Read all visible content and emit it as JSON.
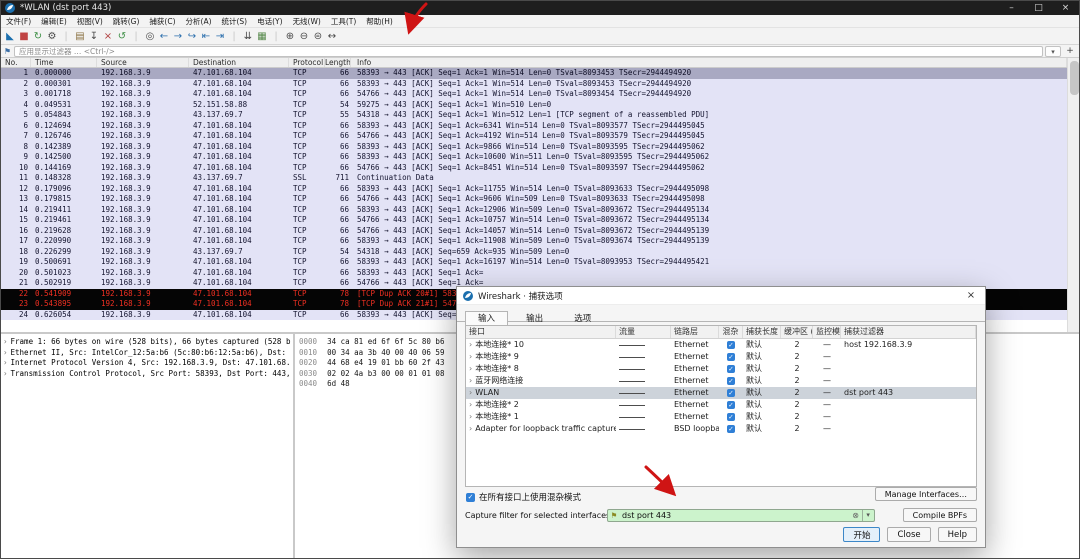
{
  "glyphs": {
    "check": "✓",
    "expander": "›",
    "minimize": "–",
    "maximize": "□",
    "close": "×",
    "dropdown": "▾",
    "add": "+",
    "bookmark": "⚑",
    "clear": "⊗"
  },
  "window": {
    "title": "*WLAN (dst port 443)"
  },
  "menubar": {
    "items": [
      "文件(F)",
      "编辑(E)",
      "视图(V)",
      "跳转(G)",
      "捕获(C)",
      "分析(A)",
      "统计(S)",
      "电话(Y)",
      "无线(W)",
      "工具(T)",
      "帮助(H)"
    ]
  },
  "toolbar": {
    "icons": [
      {
        "name": "start-capture-icon",
        "glyph": "◣",
        "color": "#1b6fae"
      },
      {
        "name": "stop-capture-icon",
        "glyph": "■",
        "color": "#c04343"
      },
      {
        "name": "restart-capture-icon",
        "glyph": "↻",
        "color": "#3d8f45"
      },
      {
        "name": "capture-options-icon",
        "glyph": "⚙",
        "color": "#4a4a4a"
      },
      {
        "name": "toolbar-separator",
        "glyph": "|",
        "color": "#c8c8c8"
      },
      {
        "name": "open-file-icon",
        "glyph": "▤",
        "color": "#8a7040"
      },
      {
        "name": "save-file-icon",
        "glyph": "↧",
        "color": "#4a4a4a"
      },
      {
        "name": "close-file-icon",
        "glyph": "×",
        "color": "#b04040"
      },
      {
        "name": "reload-file-icon",
        "glyph": "↺",
        "color": "#3d8f45"
      },
      {
        "name": "toolbar-separator",
        "glyph": "|",
        "color": "#c8c8c8"
      },
      {
        "name": "find-packet-icon",
        "glyph": "◎",
        "color": "#4a4a4a"
      },
      {
        "name": "go-back-icon",
        "glyph": "←",
        "color": "#2c6fad"
      },
      {
        "name": "go-forward-icon",
        "glyph": "→",
        "color": "#2c6fad"
      },
      {
        "name": "go-to-packet-icon",
        "glyph": "↪",
        "color": "#2c6fad"
      },
      {
        "name": "go-first-icon",
        "glyph": "⇤",
        "color": "#2c6fad"
      },
      {
        "name": "go-last-icon",
        "glyph": "⇥",
        "color": "#2c6fad"
      },
      {
        "name": "toolbar-separator",
        "glyph": "|",
        "color": "#c8c8c8"
      },
      {
        "name": "auto-scroll-icon",
        "glyph": "⇊",
        "color": "#4a4a4a"
      },
      {
        "name": "colorize-icon",
        "glyph": "▦",
        "color": "#55884a"
      },
      {
        "name": "toolbar-separator",
        "glyph": "|",
        "color": "#c8c8c8"
      },
      {
        "name": "zoom-in-icon",
        "glyph": "⊕",
        "color": "#4a4a4a"
      },
      {
        "name": "zoom-out-icon",
        "glyph": "⊖",
        "color": "#4a4a4a"
      },
      {
        "name": "zoom-reset-icon",
        "glyph": "⊜",
        "color": "#4a4a4a"
      },
      {
        "name": "resize-columns-icon",
        "glyph": "↔",
        "color": "#4a4a4a"
      }
    ]
  },
  "filter_bar": {
    "placeholder": "应用显示过滤器 … <Ctrl-/>"
  },
  "packet_list": {
    "columns": [
      "No.",
      "Time",
      "Source",
      "Destination",
      "Protocol",
      "Length",
      "Info"
    ],
    "rows": [
      {
        "no": "1",
        "time": "0.000000",
        "source": "192.168.3.9",
        "destination": "47.101.68.104",
        "protocol": "TCP",
        "length": "66",
        "info": "58393 → 443 [ACK] Seq=1 Ack=1 Win=514 Len=0 TSval=8093453 TSecr=2944494920",
        "style": "selected"
      },
      {
        "no": "2",
        "time": "0.000301",
        "source": "192.168.3.9",
        "destination": "47.101.68.104",
        "protocol": "TCP",
        "length": "66",
        "info": "58393 → 443 [ACK] Seq=1 Ack=1 Win=514 Len=0 TSval=8093453 TSecr=2944494920"
      },
      {
        "no": "3",
        "time": "0.001718",
        "source": "192.168.3.9",
        "destination": "47.101.68.104",
        "protocol": "TCP",
        "length": "66",
        "info": "54766 → 443 [ACK] Seq=1 Ack=1 Win=514 Len=0 TSval=8093454 TSecr=2944494920"
      },
      {
        "no": "4",
        "time": "0.049531",
        "source": "192.168.3.9",
        "destination": "52.151.58.88",
        "protocol": "TCP",
        "length": "54",
        "info": "59275 → 443 [ACK] Seq=1 Ack=1 Win=510 Len=0"
      },
      {
        "no": "5",
        "time": "0.054843",
        "source": "192.168.3.9",
        "destination": "43.137.69.7",
        "protocol": "TCP",
        "length": "55",
        "info": "54318 → 443 [ACK] Seq=1 Ack=1 Win=512 Len=1 [TCP segment of a reassembled PDU]"
      },
      {
        "no": "6",
        "time": "0.124694",
        "source": "192.168.3.9",
        "destination": "47.101.68.104",
        "protocol": "TCP",
        "length": "66",
        "info": "58393 → 443 [ACK] Seq=1 Ack=6341 Win=514 Len=0 TSval=8093577 TSecr=2944495045"
      },
      {
        "no": "7",
        "time": "0.126746",
        "source": "192.168.3.9",
        "destination": "47.101.68.104",
        "protocol": "TCP",
        "length": "66",
        "info": "54766 → 443 [ACK] Seq=1 Ack=4192 Win=514 Len=0 TSval=8093579 TSecr=2944495045"
      },
      {
        "no": "8",
        "time": "0.142389",
        "source": "192.168.3.9",
        "destination": "47.101.68.104",
        "protocol": "TCP",
        "length": "66",
        "info": "58393 → 443 [ACK] Seq=1 Ack=9866 Win=514 Len=0 TSval=8093595 TSecr=2944495062"
      },
      {
        "no": "9",
        "time": "0.142500",
        "source": "192.168.3.9",
        "destination": "47.101.68.104",
        "protocol": "TCP",
        "length": "66",
        "info": "58393 → 443 [ACK] Seq=1 Ack=10600 Win=511 Len=0 TSval=8093595 TSecr=2944495062"
      },
      {
        "no": "10",
        "time": "0.144169",
        "source": "192.168.3.9",
        "destination": "47.101.68.104",
        "protocol": "TCP",
        "length": "66",
        "info": "54766 → 443 [ACK] Seq=1 Ack=8451 Win=514 Len=0 TSval=8093597 TSecr=2944495062"
      },
      {
        "no": "11",
        "time": "0.148328",
        "source": "192.168.3.9",
        "destination": "43.137.69.7",
        "protocol": "SSL",
        "length": "711",
        "info": "Continuation Data"
      },
      {
        "no": "12",
        "time": "0.179096",
        "source": "192.168.3.9",
        "destination": "47.101.68.104",
        "protocol": "TCP",
        "length": "66",
        "info": "58393 → 443 [ACK] Seq=1 Ack=11755 Win=514 Len=0 TSval=8093633 TSecr=2944495098"
      },
      {
        "no": "13",
        "time": "0.179815",
        "source": "192.168.3.9",
        "destination": "47.101.68.104",
        "protocol": "TCP",
        "length": "66",
        "info": "54766 → 443 [ACK] Seq=1 Ack=9606 Win=509 Len=0 TSval=8093633 TSecr=2944495098"
      },
      {
        "no": "14",
        "time": "0.219411",
        "source": "192.168.3.9",
        "destination": "47.101.68.104",
        "protocol": "TCP",
        "length": "66",
        "info": "58393 → 443 [ACK] Seq=1 Ack=12906 Win=509 Len=0 TSval=8093672 TSecr=2944495134"
      },
      {
        "no": "15",
        "time": "0.219461",
        "source": "192.168.3.9",
        "destination": "47.101.68.104",
        "protocol": "TCP",
        "length": "66",
        "info": "54766 → 443 [ACK] Seq=1 Ack=10757 Win=514 Len=0 TSval=8093672 TSecr=2944495134"
      },
      {
        "no": "16",
        "time": "0.219628",
        "source": "192.168.3.9",
        "destination": "47.101.68.104",
        "protocol": "TCP",
        "length": "66",
        "info": "54766 → 443 [ACK] Seq=1 Ack=14057 Win=514 Len=0 TSval=8093672 TSecr=2944495139"
      },
      {
        "no": "17",
        "time": "0.220990",
        "source": "192.168.3.9",
        "destination": "47.101.68.104",
        "protocol": "TCP",
        "length": "66",
        "info": "58393 → 443 [ACK] Seq=1 Ack=11908 Win=509 Len=0 TSval=8093674 TSecr=2944495139"
      },
      {
        "no": "18",
        "time": "0.226299",
        "source": "192.168.3.9",
        "destination": "43.137.69.7",
        "protocol": "TCP",
        "length": "54",
        "info": "54318 → 443 [ACK] Seq=659 Ack=935 Win=509 Len=0"
      },
      {
        "no": "19",
        "time": "0.500691",
        "source": "192.168.3.9",
        "destination": "47.101.68.104",
        "protocol": "TCP",
        "length": "66",
        "info": "58393 → 443 [ACK] Seq=1 Ack=16197 Win=514 Len=0 TSval=8093953 TSecr=2944495421"
      },
      {
        "no": "20",
        "time": "0.501023",
        "source": "192.168.3.9",
        "destination": "47.101.68.104",
        "protocol": "TCP",
        "length": "66",
        "info": "58393 → 443 [ACK] Seq=1 Ack="
      },
      {
        "no": "21",
        "time": "0.502919",
        "source": "192.168.3.9",
        "destination": "47.101.68.104",
        "protocol": "TCP",
        "length": "66",
        "info": "54766 → 443 [ACK] Seq=1 Ack="
      },
      {
        "no": "22",
        "time": "0.541909",
        "source": "192.168.3.9",
        "destination": "47.101.68.104",
        "protocol": "TCP",
        "length": "78",
        "info": "[TCP Dup ACK 20#1] 58393 → 443 [ACK]",
        "style": "bad"
      },
      {
        "no": "23",
        "time": "0.543895",
        "source": "192.168.3.9",
        "destination": "47.101.68.104",
        "protocol": "TCP",
        "length": "78",
        "info": "[TCP Dup ACK 21#1] 54766 → 443 [ACK]",
        "style": "bad"
      },
      {
        "no": "24",
        "time": "0.626054",
        "source": "192.168.3.9",
        "destination": "47.101.68.104",
        "protocol": "TCP",
        "length": "66",
        "info": "58393 → 443 [ACK] Seq=1 Ack="
      }
    ]
  },
  "details": {
    "lines": [
      "Frame 1: 66 bytes on wire (528 bits), 66 bytes captured (528 b",
      "Ethernet II, Src: IntelCor_12:5a:b6 (5c:80:b6:12:5a:b6), Dst:",
      "Internet Protocol Version 4, Src: 192.168.3.9, Dst: 47.101.68.",
      "Transmission Control Protocol, Src Port: 58393, Dst Port: 443,"
    ]
  },
  "hex": {
    "lines": [
      {
        "offset": "0000",
        "bytes": "34 ca 81 ed 6f 6f 5c 80  b6"
      },
      {
        "offset": "0010",
        "bytes": "00 34 aa 3b 40 00 40 06  59"
      },
      {
        "offset": "0020",
        "bytes": "44 68 e4 19 01 bb 60 2f  43"
      },
      {
        "offset": "0030",
        "bytes": "02 02 4a b3 00 00 01 01  08"
      },
      {
        "offset": "0040",
        "bytes": "6d 48"
      }
    ]
  },
  "dialog": {
    "title": "Wireshark · 捕获选项",
    "tabs": [
      {
        "label": "输入",
        "style": "active"
      },
      {
        "label": "输出"
      },
      {
        "label": "选项"
      }
    ],
    "table": {
      "columns": [
        "接口",
        "流量",
        "链路层",
        "混杂",
        "捕获长度 B",
        "缓冲区 (M",
        "监控模",
        "捕获过滤器"
      ],
      "rows": [
        {
          "iface": "本地连接* 10",
          "link": "Ethernet",
          "snaplen": "默认",
          "buffer": "2",
          "monitor": "—",
          "filter": "host 192.168.3.9"
        },
        {
          "iface": "本地连接* 9",
          "link": "Ethernet",
          "snaplen": "默认",
          "buffer": "2",
          "monitor": "—",
          "filter": ""
        },
        {
          "iface": "本地连接* 8",
          "link": "Ethernet",
          "snaplen": "默认",
          "buffer": "2",
          "monitor": "—",
          "filter": ""
        },
        {
          "iface": "蓝牙网络连接",
          "link": "Ethernet",
          "snaplen": "默认",
          "buffer": "2",
          "monitor": "—",
          "filter": ""
        },
        {
          "iface": "WLAN",
          "link": "Ethernet",
          "snaplen": "默认",
          "buffer": "2",
          "monitor": "—",
          "filter": "dst port 443",
          "style": "selected"
        },
        {
          "iface": "本地连接* 2",
          "link": "Ethernet",
          "snaplen": "默认",
          "buffer": "2",
          "monitor": "—",
          "filter": ""
        },
        {
          "iface": "本地连接* 1",
          "link": "Ethernet",
          "snaplen": "默认",
          "buffer": "2",
          "monitor": "—",
          "filter": ""
        },
        {
          "iface": "Adapter for loopback traffic capture",
          "link": "BSD loopback",
          "snaplen": "默认",
          "buffer": "2",
          "monitor": "—",
          "filter": ""
        }
      ]
    },
    "promiscuous_checkbox_label": "在所有接口上使用混杂模式",
    "manage_interfaces_button": "Manage Interfaces…",
    "capture_filter_label": "Capture filter for selected interfaces:",
    "capture_filter_value": "dst port 443",
    "compile_button": "Compile BPFs",
    "start_button": "开始",
    "close_button": "Close",
    "help_button": "Help"
  }
}
